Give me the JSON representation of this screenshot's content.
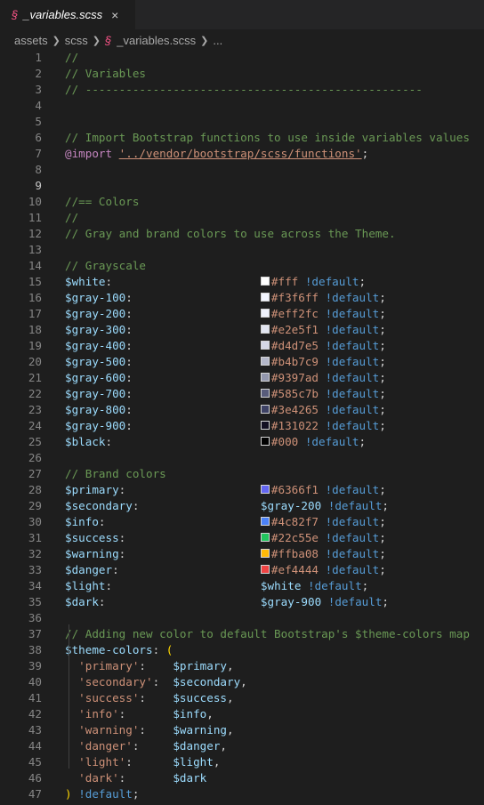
{
  "tab": {
    "icon": "sass-icon",
    "label": "_variables.scss",
    "close": "×"
  },
  "breadcrumb": {
    "items": [
      "assets",
      "scss",
      "_variables.scss",
      "..."
    ]
  },
  "colors": {
    "background": "#1e1e1e",
    "comment": "#6a9955",
    "variable": "#9cdcfe",
    "keyword": "#569cd6",
    "string": "#ce9178",
    "at_rule": "#c586c0"
  },
  "lines": [
    {
      "n": "1",
      "tokens": [
        {
          "t": "//",
          "c": "c"
        }
      ]
    },
    {
      "n": "2",
      "tokens": [
        {
          "t": "// Variables",
          "c": "c"
        }
      ]
    },
    {
      "n": "3",
      "tokens": [
        {
          "t": "// --------------------------------------------------",
          "c": "c"
        }
      ]
    },
    {
      "n": "4",
      "tokens": []
    },
    {
      "n": "5",
      "tokens": []
    },
    {
      "n": "6",
      "tokens": [
        {
          "t": "// Import Bootstrap functions to use inside variables values",
          "c": "c"
        }
      ]
    },
    {
      "n": "7",
      "tokens": [
        {
          "t": "@import",
          "c": "at"
        },
        {
          "t": " ",
          "c": "pun"
        },
        {
          "t": "'../vendor/bootstrap/scss/functions'",
          "c": "str"
        },
        {
          "t": ";",
          "c": "pun"
        }
      ]
    },
    {
      "n": "8",
      "tokens": []
    },
    {
      "n": "9",
      "active": true,
      "tokens": []
    },
    {
      "n": "10",
      "tokens": [
        {
          "t": "//== Colors",
          "c": "c"
        }
      ]
    },
    {
      "n": "11",
      "tokens": [
        {
          "t": "//",
          "c": "c"
        }
      ]
    },
    {
      "n": "12",
      "tokens": [
        {
          "t": "// Gray and brand colors to use across the Theme.",
          "c": "c"
        }
      ]
    },
    {
      "n": "13",
      "tokens": []
    },
    {
      "n": "14",
      "tokens": [
        {
          "t": "// Grayscale",
          "c": "c"
        }
      ]
    },
    {
      "n": "15",
      "tokens": [
        {
          "t": "$white",
          "c": "var"
        },
        {
          "t": ":",
          "c": "pun"
        },
        {
          "t": "                      ",
          "c": "pun"
        },
        {
          "sw": "#ffffff"
        },
        {
          "t": "#fff",
          "c": "hex"
        },
        {
          "t": " ",
          "c": "pun"
        },
        {
          "t": "!default",
          "c": "def"
        },
        {
          "t": ";",
          "c": "pun"
        }
      ]
    },
    {
      "n": "16",
      "tokens": [
        {
          "t": "$gray-100",
          "c": "var"
        },
        {
          "t": ":",
          "c": "pun"
        },
        {
          "t": "                   ",
          "c": "pun"
        },
        {
          "sw": "#f3f6ff"
        },
        {
          "t": "#f3f6ff",
          "c": "hex"
        },
        {
          "t": " ",
          "c": "pun"
        },
        {
          "t": "!default",
          "c": "def"
        },
        {
          "t": ";",
          "c": "pun"
        }
      ]
    },
    {
      "n": "17",
      "tokens": [
        {
          "t": "$gray-200",
          "c": "var"
        },
        {
          "t": ":",
          "c": "pun"
        },
        {
          "t": "                   ",
          "c": "pun"
        },
        {
          "sw": "#eff2fc"
        },
        {
          "t": "#eff2fc",
          "c": "hex"
        },
        {
          "t": " ",
          "c": "pun"
        },
        {
          "t": "!default",
          "c": "def"
        },
        {
          "t": ";",
          "c": "pun"
        }
      ]
    },
    {
      "n": "18",
      "tokens": [
        {
          "t": "$gray-300",
          "c": "var"
        },
        {
          "t": ":",
          "c": "pun"
        },
        {
          "t": "                   ",
          "c": "pun"
        },
        {
          "sw": "#e2e5f1"
        },
        {
          "t": "#e2e5f1",
          "c": "hex"
        },
        {
          "t": " ",
          "c": "pun"
        },
        {
          "t": "!default",
          "c": "def"
        },
        {
          "t": ";",
          "c": "pun"
        }
      ]
    },
    {
      "n": "19",
      "tokens": [
        {
          "t": "$gray-400",
          "c": "var"
        },
        {
          "t": ":",
          "c": "pun"
        },
        {
          "t": "                   ",
          "c": "pun"
        },
        {
          "sw": "#d4d7e5"
        },
        {
          "t": "#d4d7e5",
          "c": "hex"
        },
        {
          "t": " ",
          "c": "pun"
        },
        {
          "t": "!default",
          "c": "def"
        },
        {
          "t": ";",
          "c": "pun"
        }
      ]
    },
    {
      "n": "20",
      "tokens": [
        {
          "t": "$gray-500",
          "c": "var"
        },
        {
          "t": ":",
          "c": "pun"
        },
        {
          "t": "                   ",
          "c": "pun"
        },
        {
          "sw": "#b4b7c9"
        },
        {
          "t": "#b4b7c9",
          "c": "hex"
        },
        {
          "t": " ",
          "c": "pun"
        },
        {
          "t": "!default",
          "c": "def"
        },
        {
          "t": ";",
          "c": "pun"
        }
      ]
    },
    {
      "n": "21",
      "tokens": [
        {
          "t": "$gray-600",
          "c": "var"
        },
        {
          "t": ":",
          "c": "pun"
        },
        {
          "t": "                   ",
          "c": "pun"
        },
        {
          "sw": "#9397ad"
        },
        {
          "t": "#9397ad",
          "c": "hex"
        },
        {
          "t": " ",
          "c": "pun"
        },
        {
          "t": "!default",
          "c": "def"
        },
        {
          "t": ";",
          "c": "pun"
        }
      ]
    },
    {
      "n": "22",
      "tokens": [
        {
          "t": "$gray-700",
          "c": "var"
        },
        {
          "t": ":",
          "c": "pun"
        },
        {
          "t": "                   ",
          "c": "pun"
        },
        {
          "sw": "#585c7b"
        },
        {
          "t": "#585c7b",
          "c": "hex"
        },
        {
          "t": " ",
          "c": "pun"
        },
        {
          "t": "!default",
          "c": "def"
        },
        {
          "t": ";",
          "c": "pun"
        }
      ]
    },
    {
      "n": "23",
      "tokens": [
        {
          "t": "$gray-800",
          "c": "var"
        },
        {
          "t": ":",
          "c": "pun"
        },
        {
          "t": "                   ",
          "c": "pun"
        },
        {
          "sw": "#3e4265"
        },
        {
          "t": "#3e4265",
          "c": "hex"
        },
        {
          "t": " ",
          "c": "pun"
        },
        {
          "t": "!default",
          "c": "def"
        },
        {
          "t": ";",
          "c": "pun"
        }
      ]
    },
    {
      "n": "24",
      "tokens": [
        {
          "t": "$gray-900",
          "c": "var"
        },
        {
          "t": ":",
          "c": "pun"
        },
        {
          "t": "                   ",
          "c": "pun"
        },
        {
          "sw": "#131022"
        },
        {
          "t": "#131022",
          "c": "hex"
        },
        {
          "t": " ",
          "c": "pun"
        },
        {
          "t": "!default",
          "c": "def"
        },
        {
          "t": ";",
          "c": "pun"
        }
      ]
    },
    {
      "n": "25",
      "tokens": [
        {
          "t": "$black",
          "c": "var"
        },
        {
          "t": ":",
          "c": "pun"
        },
        {
          "t": "                      ",
          "c": "pun"
        },
        {
          "sw": "#000000"
        },
        {
          "t": "#000",
          "c": "hex"
        },
        {
          "t": " ",
          "c": "pun"
        },
        {
          "t": "!default",
          "c": "def"
        },
        {
          "t": ";",
          "c": "pun"
        }
      ]
    },
    {
      "n": "26",
      "tokens": []
    },
    {
      "n": "27",
      "tokens": [
        {
          "t": "// Brand colors",
          "c": "c"
        }
      ]
    },
    {
      "n": "28",
      "tokens": [
        {
          "t": "$primary",
          "c": "var"
        },
        {
          "t": ":",
          "c": "pun"
        },
        {
          "t": "                    ",
          "c": "pun"
        },
        {
          "sw": "#6366f1"
        },
        {
          "t": "#6366f1",
          "c": "hex"
        },
        {
          "t": " ",
          "c": "pun"
        },
        {
          "t": "!default",
          "c": "def"
        },
        {
          "t": ";",
          "c": "pun"
        }
      ]
    },
    {
      "n": "29",
      "tokens": [
        {
          "t": "$secondary",
          "c": "var"
        },
        {
          "t": ":",
          "c": "pun"
        },
        {
          "t": "                  ",
          "c": "pun"
        },
        {
          "t": "$gray-200",
          "c": "var"
        },
        {
          "t": " ",
          "c": "pun"
        },
        {
          "t": "!default",
          "c": "def"
        },
        {
          "t": ";",
          "c": "pun"
        }
      ]
    },
    {
      "n": "30",
      "tokens": [
        {
          "t": "$info",
          "c": "var"
        },
        {
          "t": ":",
          "c": "pun"
        },
        {
          "t": "                       ",
          "c": "pun"
        },
        {
          "sw": "#4c82f7"
        },
        {
          "t": "#4c82f7",
          "c": "hex"
        },
        {
          "t": " ",
          "c": "pun"
        },
        {
          "t": "!default",
          "c": "def"
        },
        {
          "t": ";",
          "c": "pun"
        }
      ]
    },
    {
      "n": "31",
      "tokens": [
        {
          "t": "$success",
          "c": "var"
        },
        {
          "t": ":",
          "c": "pun"
        },
        {
          "t": "                    ",
          "c": "pun"
        },
        {
          "sw": "#22c55e"
        },
        {
          "t": "#22c55e",
          "c": "hex"
        },
        {
          "t": " ",
          "c": "pun"
        },
        {
          "t": "!default",
          "c": "def"
        },
        {
          "t": ";",
          "c": "pun"
        }
      ]
    },
    {
      "n": "32",
      "tokens": [
        {
          "t": "$warning",
          "c": "var"
        },
        {
          "t": ":",
          "c": "pun"
        },
        {
          "t": "                    ",
          "c": "pun"
        },
        {
          "sw": "#ffba08"
        },
        {
          "t": "#ffba08",
          "c": "hex"
        },
        {
          "t": " ",
          "c": "pun"
        },
        {
          "t": "!default",
          "c": "def"
        },
        {
          "t": ";",
          "c": "pun"
        }
      ]
    },
    {
      "n": "33",
      "tokens": [
        {
          "t": "$danger",
          "c": "var"
        },
        {
          "t": ":",
          "c": "pun"
        },
        {
          "t": "                     ",
          "c": "pun"
        },
        {
          "sw": "#ef4444"
        },
        {
          "t": "#ef4444",
          "c": "hex"
        },
        {
          "t": " ",
          "c": "pun"
        },
        {
          "t": "!default",
          "c": "def"
        },
        {
          "t": ";",
          "c": "pun"
        }
      ]
    },
    {
      "n": "34",
      "tokens": [
        {
          "t": "$light",
          "c": "var"
        },
        {
          "t": ":",
          "c": "pun"
        },
        {
          "t": "                      ",
          "c": "pun"
        },
        {
          "t": "$white",
          "c": "var"
        },
        {
          "t": " ",
          "c": "pun"
        },
        {
          "t": "!default",
          "c": "def"
        },
        {
          "t": ";",
          "c": "pun"
        }
      ]
    },
    {
      "n": "35",
      "tokens": [
        {
          "t": "$dark",
          "c": "var"
        },
        {
          "t": ":",
          "c": "pun"
        },
        {
          "t": "                       ",
          "c": "pun"
        },
        {
          "t": "$gray-900",
          "c": "var"
        },
        {
          "t": " ",
          "c": "pun"
        },
        {
          "t": "!default",
          "c": "def"
        },
        {
          "t": ";",
          "c": "pun"
        }
      ]
    },
    {
      "n": "36",
      "tokens": []
    },
    {
      "n": "37",
      "tokens": [
        {
          "t": "// Adding new color to default Bootstrap's $theme-colors map",
          "c": "c"
        }
      ]
    },
    {
      "n": "38",
      "tokens": [
        {
          "t": "$theme-colors",
          "c": "var"
        },
        {
          "t": ": ",
          "c": "pun"
        },
        {
          "t": "(",
          "c": "paren"
        }
      ]
    },
    {
      "n": "39",
      "tokens": [
        {
          "t": "  ",
          "c": "pun"
        },
        {
          "t": "'primary'",
          "c": "sq"
        },
        {
          "t": ":    ",
          "c": "pun"
        },
        {
          "t": "$primary",
          "c": "var"
        },
        {
          "t": ",",
          "c": "pun"
        }
      ]
    },
    {
      "n": "40",
      "tokens": [
        {
          "t": "  ",
          "c": "pun"
        },
        {
          "t": "'secondary'",
          "c": "sq"
        },
        {
          "t": ":  ",
          "c": "pun"
        },
        {
          "t": "$secondary",
          "c": "var"
        },
        {
          "t": ",",
          "c": "pun"
        }
      ]
    },
    {
      "n": "41",
      "tokens": [
        {
          "t": "  ",
          "c": "pun"
        },
        {
          "t": "'success'",
          "c": "sq"
        },
        {
          "t": ":    ",
          "c": "pun"
        },
        {
          "t": "$success",
          "c": "var"
        },
        {
          "t": ",",
          "c": "pun"
        }
      ]
    },
    {
      "n": "42",
      "tokens": [
        {
          "t": "  ",
          "c": "pun"
        },
        {
          "t": "'info'",
          "c": "sq"
        },
        {
          "t": ":       ",
          "c": "pun"
        },
        {
          "t": "$info",
          "c": "var"
        },
        {
          "t": ",",
          "c": "pun"
        }
      ]
    },
    {
      "n": "43",
      "tokens": [
        {
          "t": "  ",
          "c": "pun"
        },
        {
          "t": "'warning'",
          "c": "sq"
        },
        {
          "t": ":    ",
          "c": "pun"
        },
        {
          "t": "$warning",
          "c": "var"
        },
        {
          "t": ",",
          "c": "pun"
        }
      ]
    },
    {
      "n": "44",
      "tokens": [
        {
          "t": "  ",
          "c": "pun"
        },
        {
          "t": "'danger'",
          "c": "sq"
        },
        {
          "t": ":     ",
          "c": "pun"
        },
        {
          "t": "$danger",
          "c": "var"
        },
        {
          "t": ",",
          "c": "pun"
        }
      ]
    },
    {
      "n": "45",
      "tokens": [
        {
          "t": "  ",
          "c": "pun"
        },
        {
          "t": "'light'",
          "c": "sq"
        },
        {
          "t": ":      ",
          "c": "pun"
        },
        {
          "t": "$light",
          "c": "var"
        },
        {
          "t": ",",
          "c": "pun"
        }
      ]
    },
    {
      "n": "46",
      "tokens": [
        {
          "t": "  ",
          "c": "pun"
        },
        {
          "t": "'dark'",
          "c": "sq"
        },
        {
          "t": ":       ",
          "c": "pun"
        },
        {
          "t": "$dark",
          "c": "var"
        }
      ]
    },
    {
      "n": "47",
      "tokens": [
        {
          "t": ")",
          "c": "paren"
        },
        {
          "t": " ",
          "c": "pun"
        },
        {
          "t": "!default",
          "c": "def"
        },
        {
          "t": ";",
          "c": "pun"
        }
      ]
    }
  ]
}
